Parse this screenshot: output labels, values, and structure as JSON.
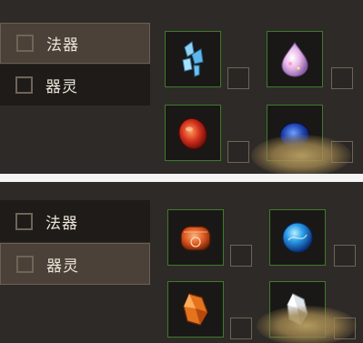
{
  "panels": [
    {
      "tabs": [
        {
          "label": "法器",
          "active": true
        },
        {
          "label": "器灵",
          "active": false
        }
      ],
      "items": [
        {
          "icon": "blue-crystal-shards-icon"
        },
        {
          "icon": "pink-water-drop-gem-icon"
        },
        {
          "icon": "red-gem-icon"
        },
        {
          "icon": "blue-gem-icon"
        }
      ]
    },
    {
      "tabs": [
        {
          "label": "法器",
          "active": false
        },
        {
          "label": "器灵",
          "active": true
        }
      ],
      "items": [
        {
          "icon": "orange-rune-stone-icon"
        },
        {
          "icon": "blue-orb-icon"
        },
        {
          "icon": "orange-crystal-icon"
        },
        {
          "icon": "white-crystal-icon"
        }
      ]
    }
  ],
  "colors": {
    "panel_bg": "#2e2a27",
    "slot_border": "#3f7a2e",
    "active_tab": "#4b4139",
    "inactive_tab": "#1e1b19"
  }
}
